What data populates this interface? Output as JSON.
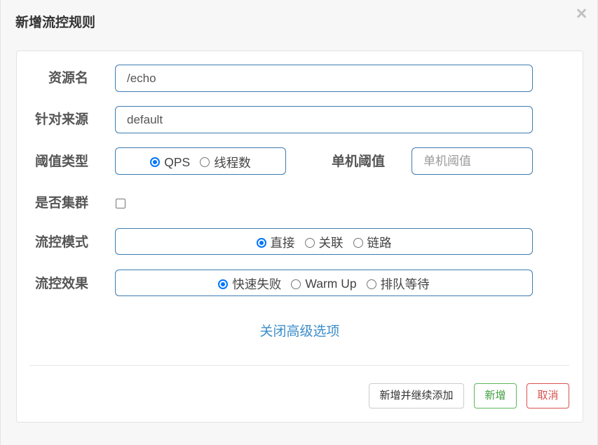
{
  "dialog": {
    "title": "新增流控规则",
    "close_glyph": "×",
    "close_icon": "close-icon"
  },
  "form": {
    "resource": {
      "label": "资源名",
      "value": "/echo"
    },
    "limit_app": {
      "label": "针对来源",
      "value": "default"
    },
    "grade": {
      "label": "阈值类型",
      "options": [
        {
          "label": "QPS",
          "checked": true
        },
        {
          "label": "线程数",
          "checked": false
        }
      ]
    },
    "count": {
      "label": "单机阈值",
      "value": "",
      "placeholder": "单机阈值"
    },
    "cluster": {
      "label": "是否集群",
      "checked": false
    },
    "strategy": {
      "label": "流控模式",
      "options": [
        {
          "label": "直接",
          "checked": true
        },
        {
          "label": "关联",
          "checked": false
        },
        {
          "label": "链路",
          "checked": false
        }
      ]
    },
    "control_behavior": {
      "label": "流控效果",
      "options": [
        {
          "label": "快速失败",
          "checked": true
        },
        {
          "label": "Warm Up",
          "checked": false
        },
        {
          "label": "排队等待",
          "checked": false
        }
      ]
    }
  },
  "advanced_toggle": {
    "label": "关闭高级选项"
  },
  "footer": {
    "add_continue_label": "新增并继续添加",
    "add_label": "新增",
    "cancel_label": "取消"
  },
  "colors": {
    "input_border": "#3e7cb1",
    "link": "#3c8dcb",
    "radio_checked": "#0075ff",
    "add_button": "#5cb85c",
    "cancel_button": "#d9534f"
  }
}
